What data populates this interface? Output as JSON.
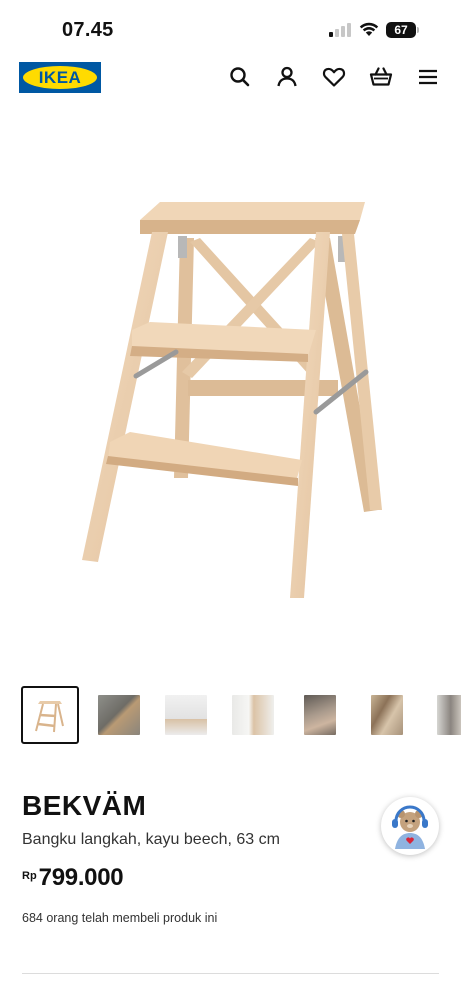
{
  "status_bar": {
    "time": "07.45",
    "battery": "67"
  },
  "header": {
    "logo_text": "IKEA",
    "icons": [
      "search-icon",
      "account-icon",
      "heart-icon",
      "basket-icon",
      "menu-icon"
    ]
  },
  "gallery": {
    "thumbnails": [
      {
        "name": "stool-thumb",
        "active": true
      },
      {
        "name": "room-thumb-1",
        "active": false
      },
      {
        "name": "room-thumb-2",
        "active": false
      },
      {
        "name": "room-thumb-3",
        "active": false
      },
      {
        "name": "room-thumb-4",
        "active": false
      },
      {
        "name": "room-thumb-5",
        "active": false
      },
      {
        "name": "room-thumb-6",
        "active": false
      }
    ]
  },
  "product": {
    "name": "BEKVÄM",
    "description": "Bangku langkah, kayu beech, 63 cm",
    "price_currency": "Rp",
    "price_value": "799.000",
    "buyers_text": "684 orang telah membeli produk ini"
  },
  "colors": {
    "ikea_blue": "#0058a3",
    "ikea_yellow": "#ffdb00",
    "wood": "#ecd0b1"
  }
}
